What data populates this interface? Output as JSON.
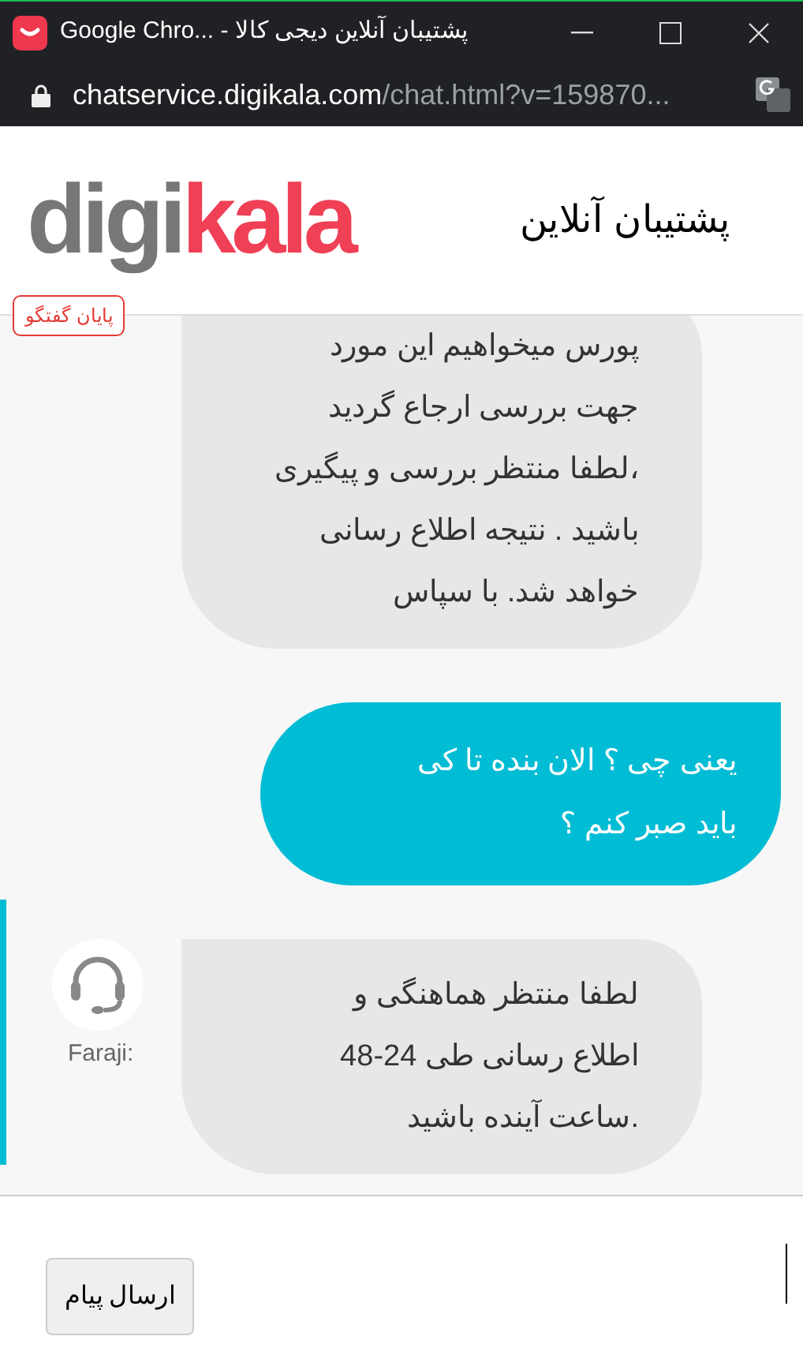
{
  "window": {
    "title": "Google Chro... - پشتیبان آنلاین دیجی کالا"
  },
  "address_bar": {
    "host": "chatservice.digikala.com",
    "path": "/chat.html?v=159870..."
  },
  "header": {
    "logo": {
      "part_1": "digi",
      "part_2": "kala"
    },
    "title": "پشتیبان آنلاین",
    "end_chat_button": "پایان گفتگو"
  },
  "messages": [
    {
      "kind": "agent",
      "lines": [
        "پورس میخواهیم این مورد",
        "جهت بررسی ارجاع گردید",
        "،لطفا منتظر بررسی و پیگیری",
        "باشید . نتیجه اطلاع رسانی",
        "خواهد شد. با سپاس"
      ]
    },
    {
      "kind": "user",
      "lines": [
        "یعنی چی ؟ الان بنده تا کی",
        "باید صبر کنم ؟"
      ]
    },
    {
      "kind": "agent",
      "sender": "Faraji:",
      "lines": [
        "لطفا منتظر هماهنگی و",
        "اطلاع رسانی طی 24-48",
        ".ساعت آینده باشید"
      ]
    }
  ],
  "composer": {
    "send_button": "ارسال پیام"
  }
}
